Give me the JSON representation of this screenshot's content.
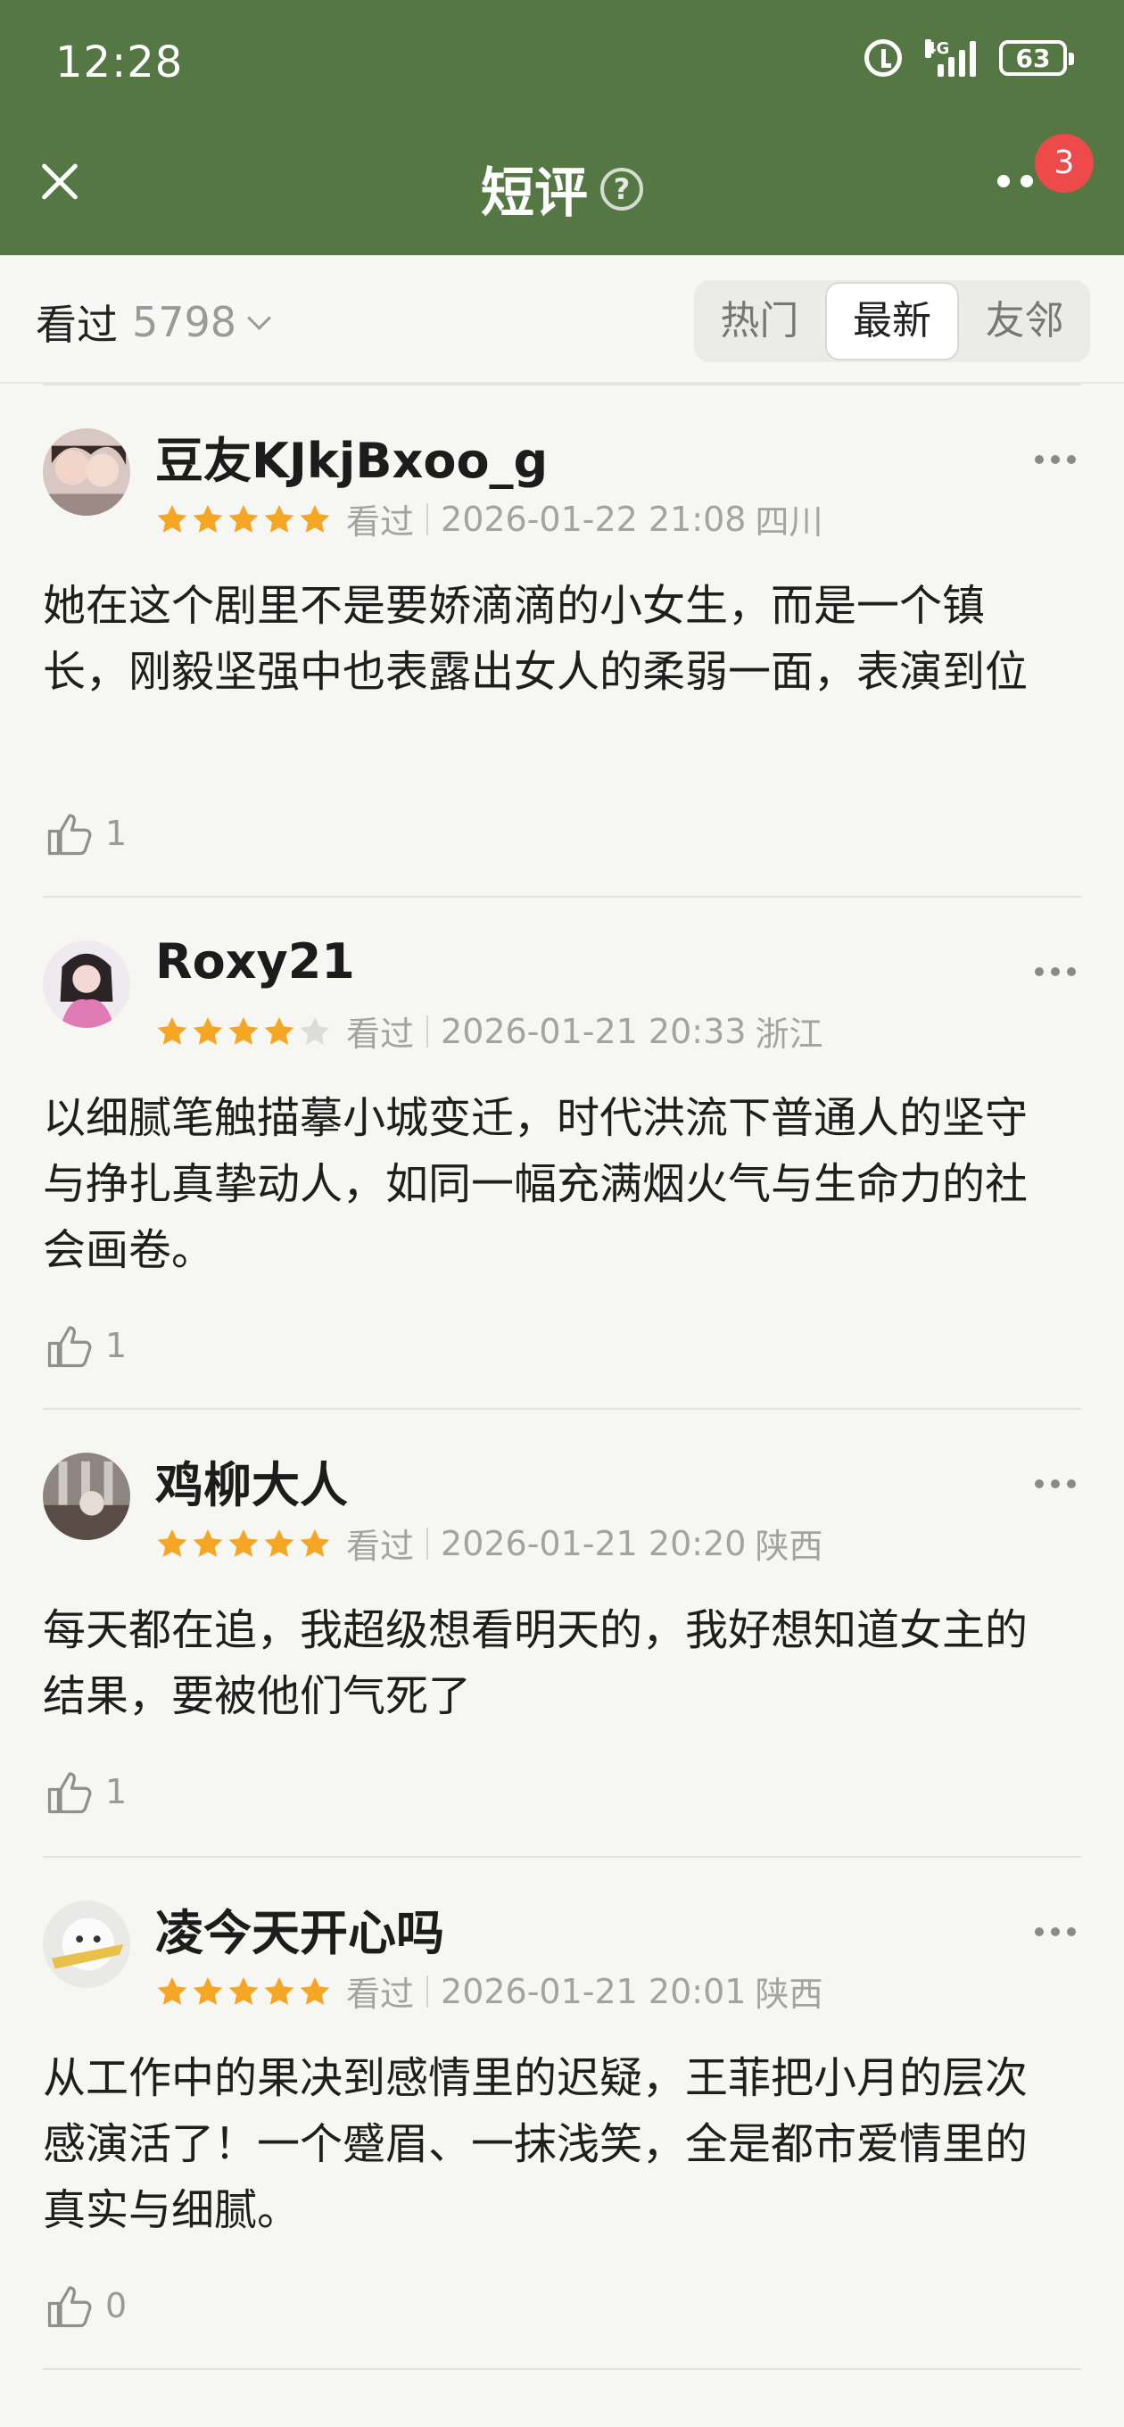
{
  "status_bar": {
    "time": "12:28",
    "network": "4G",
    "battery": "63"
  },
  "header": {
    "title": "短评",
    "help": "?",
    "badge": "3"
  },
  "filter": {
    "seen_label": "看过",
    "seen_count": "5798",
    "tabs": [
      {
        "label": "热门",
        "active": false
      },
      {
        "label": "最新",
        "active": true
      },
      {
        "label": "友邻",
        "active": false
      }
    ]
  },
  "comments": [
    {
      "user": "豆友KJkjBxoo_g",
      "rating": 5,
      "status": "看过",
      "datetime": "2026-01-22 21:08",
      "location": "四川",
      "text": "她在这个剧里不是要娇滴滴的小女生，而是一个镇长，刚毅坚强中也表露出女人的柔弱一面，表演到位",
      "likes": "1"
    },
    {
      "user": "Roxy21",
      "rating": 4,
      "status": "看过",
      "datetime": "2026-01-21 20:33",
      "location": "浙江",
      "text": "以细腻笔触描摹小城变迁，时代洪流下普通人的坚守与挣扎真挚动人，如同一幅充满烟火气与生命力的社会画卷。",
      "likes": "1"
    },
    {
      "user": "鸡柳大人",
      "rating": 5,
      "status": "看过",
      "datetime": "2026-01-21 20:20",
      "location": "陕西",
      "text": "每天都在追，我超级想看明天的，我好想知道女主的结果，要被他们气死了",
      "likes": "1"
    },
    {
      "user": "凌今天开心吗",
      "rating": 5,
      "status": "看过",
      "datetime": "2026-01-21 20:01",
      "location": "陕西",
      "text": "从工作中的果决到感情里的迟疑，王菲把小月的层次感演活了！一个蹙眉、一抹浅笑，全是都市爱情里的真实与细腻。",
      "likes": "0"
    }
  ],
  "colors": {
    "header_green": "#547744",
    "star": "#f5a623",
    "badge": "#ee4a4c"
  }
}
